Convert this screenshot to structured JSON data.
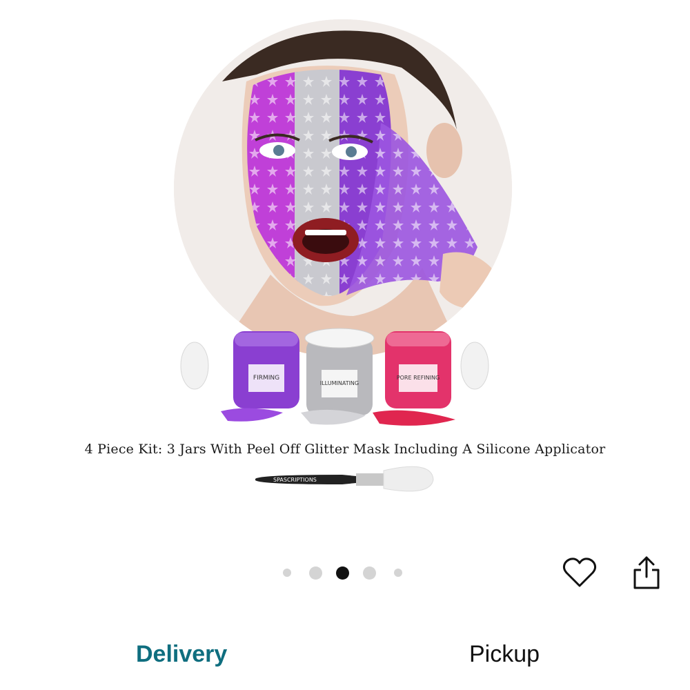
{
  "product_image": {
    "caption": "4 Piece Kit: 3 Jars  With Peel Off Glitter Mask Including A Silicone Applicator",
    "brand_mark": "SPASCRIPTIONS",
    "jars": [
      {
        "label": "FIRMING",
        "color": "#8a3fd1"
      },
      {
        "label": "ILLUMINATING",
        "color": "#b9b9bd"
      },
      {
        "label": "PORE REFINING",
        "color": "#e3336b"
      }
    ]
  },
  "pagination": {
    "total": 5,
    "active_index": 2
  },
  "actions": {
    "heart_icon": "heart-outline-icon",
    "share_icon": "share-icon"
  },
  "tabs": {
    "delivery": "Delivery",
    "pickup": "Pickup",
    "active": "delivery",
    "accent": "#0f6e7f"
  }
}
